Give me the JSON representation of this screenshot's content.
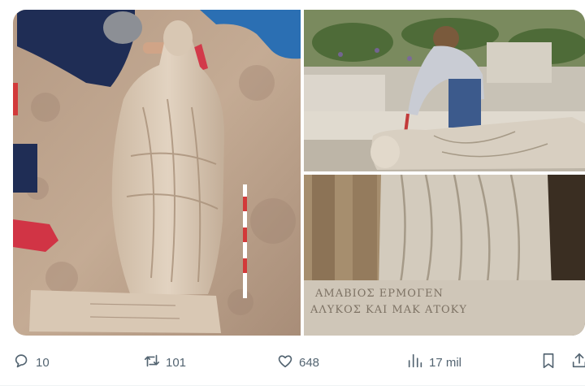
{
  "tweet": {
    "media": [
      {
        "name": "statue-excavation-photo"
      },
      {
        "name": "archaeologist-brushing-photo"
      },
      {
        "name": "inscription-closeup-photo"
      }
    ],
    "actions": {
      "reply_count": "10",
      "retweet_count": "101",
      "like_count": "648",
      "view_count": "17 mil"
    },
    "icons": {
      "reply": "reply-icon",
      "retweet": "retweet-icon",
      "like": "heart-icon",
      "views": "views-icon",
      "bookmark": "bookmark-icon",
      "share": "share-icon"
    },
    "colors": {
      "icon_gray": "#536471",
      "divider": "#eff3f4"
    }
  }
}
